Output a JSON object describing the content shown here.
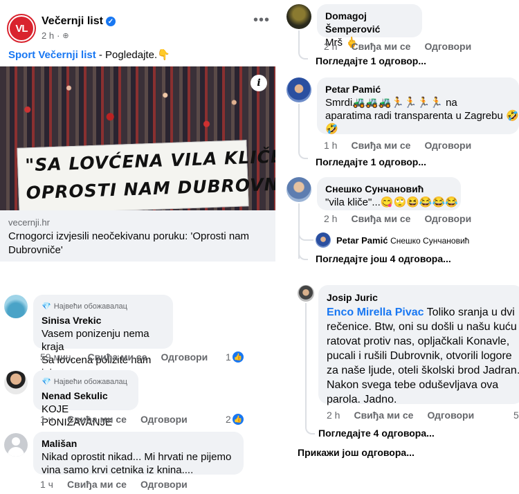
{
  "post": {
    "page_name": "Večernji list",
    "avatar_text": "VL",
    "time": "2 h",
    "text_link": "Sport Večernji list",
    "text_rest": " - Pogledajte.👇",
    "banner_line1": "\"SA LOVĆENA VILA KLIČE",
    "banner_line2": "OPROSTI NAM DUBROVNIČE\"",
    "link_domain": "vecernji.hr",
    "link_title": "Crnogorci izvjesili neočekivanu poruku: 'Oprosti nam Dubrovniče'"
  },
  "labels": {
    "like": "Свиђа ми се",
    "reply": "Одговори",
    "top_fan": "Највећи обожавалац"
  },
  "left_comments": [
    {
      "name": "Sinisa Vrekic",
      "line1": "Vasem ponizenju nema kraja",
      "line2": "Sa lovcena polizite nam jaja",
      "time": "59 мин.",
      "likes": "1"
    },
    {
      "name": "Nenad Sekulic",
      "line1": "KOJE PONIŽAVANJE",
      "time": "1 ч",
      "likes": "2"
    },
    {
      "name": "Mališan",
      "line1": "Nikad oprostit nikad... Mi hrvati ne pijemo",
      "line2": "vina samo krvi cetnika iz knina....",
      "time": "1 ч"
    }
  ],
  "right_comments": [
    {
      "name": "Domagoj Šemperović",
      "text": "Mrš 🖕",
      "time": "2 h",
      "like": "Свиђа ми се",
      "reply": "Одговори",
      "replies": "Погледајте 1 одговор..."
    },
    {
      "name": "Petar Pamić",
      "line1": "Smrdi🚜🚜🚜🏃🏃🏃🏃 na",
      "line2": "aparatima radi transparenta u Zagrebu 🤣",
      "line3": "🤣",
      "time": "1 h",
      "like": "Свиђа ми се",
      "reply": "Одговори",
      "replies": "Погледајте 1 одговор..."
    },
    {
      "name": "Снешко Сунчановић",
      "text": "\"vila kliče\"...😋🙄😆😂😂😂",
      "time": "2 h",
      "like": "Свиђа ми се",
      "reply": "Одговори",
      "reply_preview": {
        "name": "Petar Pamić",
        "mention": "Снешко Сунчановић"
      },
      "replies": "Погледајте још 4 одговора..."
    },
    {
      "name": "Josip Juric",
      "mention": "Enco Mirella Pivac",
      "line1": " Toliko sranja u dvi",
      "line2": "rečenice. Btw, oni su došli u našu kuću",
      "line3": "ratovat protiv nas, opljačkali Konavle,",
      "line4": "pucali i rušili Dubrovnik, otvorili logore",
      "line5": "za naše ljude, oteli školski brod Jadran.",
      "line6": "Nakon svega tebe oduševljava ova",
      "line7": "parola. Jadno.",
      "time": "2 h",
      "like": "Свиђа ми се",
      "reply": "Одговори",
      "count_partial": "5",
      "replies": "Погледајте 4 одговора..."
    }
  ],
  "show_more": "Прикажи још одговора...",
  "colors": {
    "brand_red": "#d9232e",
    "link_blue": "#1877f2",
    "bubble_bg": "#f0f2f5",
    "muted": "#65676b"
  }
}
